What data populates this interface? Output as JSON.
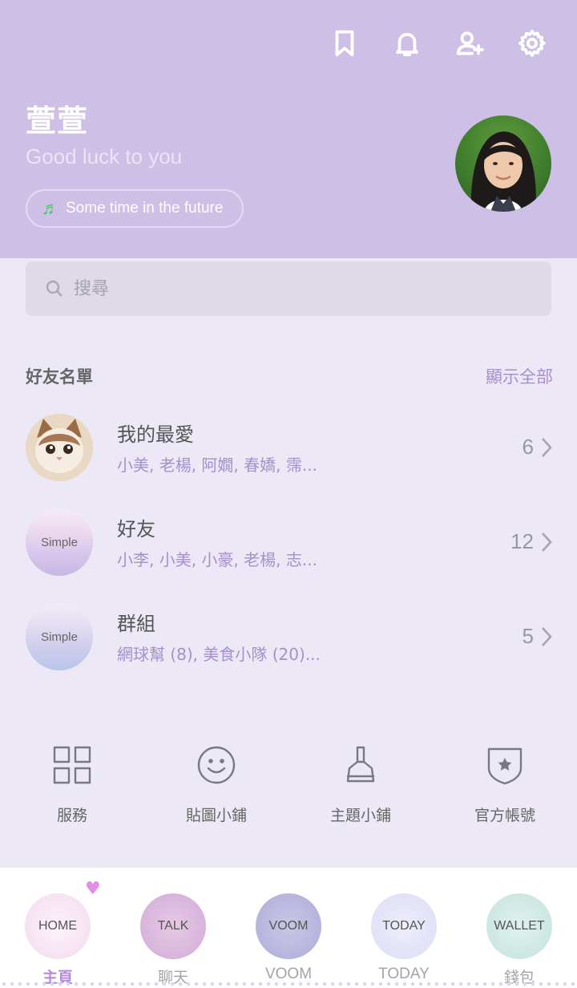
{
  "header": {
    "name": "萱萱",
    "status": "Good luck to you",
    "music": "Some time in the future",
    "icons": [
      "bookmark-icon",
      "bell-icon",
      "add-friend-icon",
      "gear-icon"
    ]
  },
  "search": {
    "placeholder": "搜尋"
  },
  "friends": {
    "title": "好友名單",
    "show_all": "顯示全部",
    "rows": [
      {
        "title": "我的最愛",
        "members": "小美, 老楊, 阿嫺, 春嬌, 霈...",
        "count": "6"
      },
      {
        "title": "好友",
        "members": "小李, 小美, 小豪, 老楊, 志...",
        "count": "12",
        "thumb": "Simple"
      },
      {
        "title": "群組",
        "members": "網球幫 (8), 美食小隊 (20)...",
        "count": "5",
        "thumb": "Simple"
      }
    ]
  },
  "shortcuts": [
    {
      "label": "服務",
      "icon": "grid-icon"
    },
    {
      "label": "貼圖小鋪",
      "icon": "smiley-icon"
    },
    {
      "label": "主題小鋪",
      "icon": "brush-icon"
    },
    {
      "label": "官方帳號",
      "icon": "shield-star-icon"
    }
  ],
  "nav": [
    {
      "bubble": "HOME",
      "label": "主頁",
      "active": true
    },
    {
      "bubble": "TALK",
      "label": "聊天"
    },
    {
      "bubble": "VOOM",
      "label": "VOOM"
    },
    {
      "bubble": "TODAY",
      "label": "TODAY"
    },
    {
      "bubble": "WALLET",
      "label": "錢包"
    }
  ],
  "colors": {
    "header_bg": "#cdbfe5",
    "page_bg": "#ece8f6",
    "accent": "#a690cc",
    "active_tab": "#b48cd6"
  }
}
